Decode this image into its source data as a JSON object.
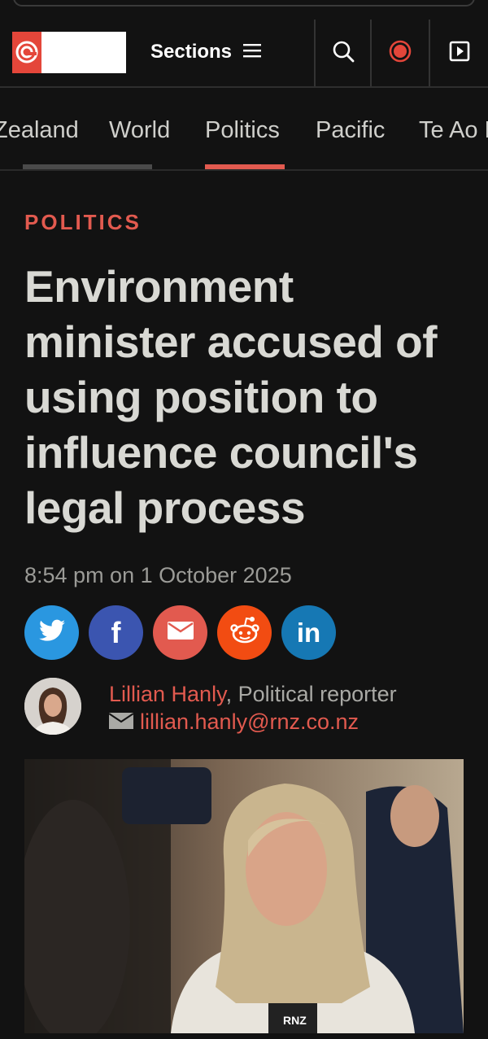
{
  "header": {
    "sections_label": "Sections",
    "icons": [
      "menu-icon",
      "search-icon",
      "live-radio-icon",
      "play-icon"
    ],
    "accent": "#e4463a"
  },
  "nav": {
    "tabs": [
      {
        "label": "Zealand"
      },
      {
        "label": "World"
      },
      {
        "label": "Politics"
      },
      {
        "label": "Pacific"
      },
      {
        "label": "Te Ao M"
      }
    ],
    "active": "Politics"
  },
  "article": {
    "kicker": "POLITICS",
    "headline": "Environment minister accused of using position to influence council's legal process",
    "date": "8:54 pm on 1 October 2025",
    "share": [
      "twitter-icon",
      "facebook-icon",
      "email-icon",
      "reddit-icon",
      "linkedin-icon"
    ],
    "author": {
      "name": "Lillian Hanly",
      "role": ", Political reporter",
      "email": "lillian.hanly@rnz.co.nz"
    },
    "photo_caption_mark": "RNZ"
  }
}
